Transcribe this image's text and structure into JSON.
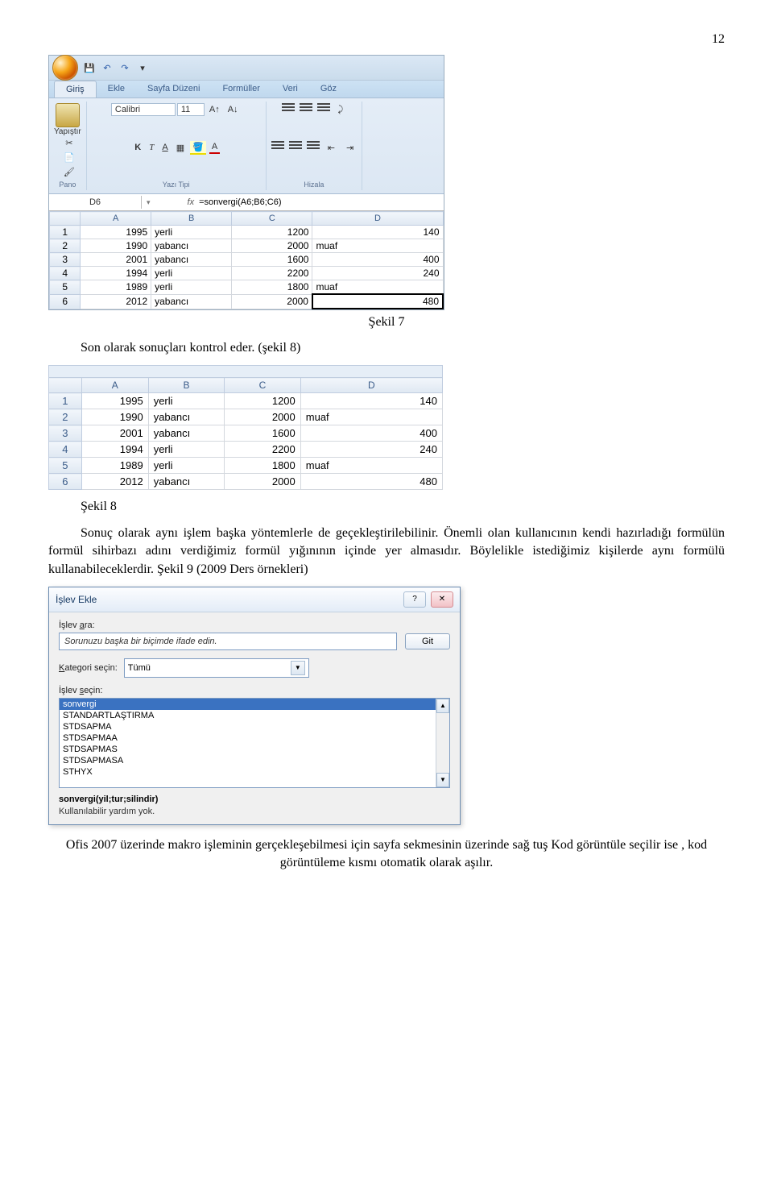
{
  "page_number": "12",
  "excel": {
    "tabs": [
      "Giriş",
      "Ekle",
      "Sayfa Düzeni",
      "Formüller",
      "Veri",
      "Göz"
    ],
    "active_tab_index": 0,
    "clipboard_group_label": "Pano",
    "paste_label": "Yapıştır",
    "font_group_label": "Yazı Tipi",
    "font_name": "Calibri",
    "font_size": "11",
    "align_group_label": "Hizala",
    "name_box_value": "D6",
    "fx_label": "fx",
    "formula_value": "=sonvergi(A6;B6;C6)",
    "columns": [
      "A",
      "B",
      "C",
      "D"
    ],
    "rows": [
      {
        "n": "1",
        "A": "1995",
        "B": "yerli",
        "C": "1200",
        "D": "140"
      },
      {
        "n": "2",
        "A": "1990",
        "B": "yabancı",
        "C": "2000",
        "D": "muaf"
      },
      {
        "n": "3",
        "A": "2001",
        "B": "yabancı",
        "C": "1600",
        "D": "400"
      },
      {
        "n": "4",
        "A": "1994",
        "B": "yerli",
        "C": "2200",
        "D": "240"
      },
      {
        "n": "5",
        "A": "1989",
        "B": "yerli",
        "C": "1800",
        "D": "muaf"
      },
      {
        "n": "6",
        "A": "2012",
        "B": "yabancı",
        "C": "2000",
        "D": "480"
      }
    ],
    "selected_cell": "D6"
  },
  "caption7": "Şekil 7",
  "para_before_sekil8": "Son olarak sonuçları kontrol eder. (şekil 8)",
  "grid8": {
    "columns": [
      "A",
      "B",
      "C",
      "D"
    ],
    "rows": [
      {
        "n": "1",
        "A": "1995",
        "B": "yerli",
        "C": "1200",
        "D": "140"
      },
      {
        "n": "2",
        "A": "1990",
        "B": "yabancı",
        "C": "2000",
        "D": "muaf"
      },
      {
        "n": "3",
        "A": "2001",
        "B": "yabancı",
        "C": "1600",
        "D": "400"
      },
      {
        "n": "4",
        "A": "1994",
        "B": "yerli",
        "C": "2200",
        "D": "240"
      },
      {
        "n": "5",
        "A": "1989",
        "B": "yerli",
        "C": "1800",
        "D": "muaf"
      },
      {
        "n": "6",
        "A": "2012",
        "B": "yabancı",
        "C": "2000",
        "D": "480"
      }
    ]
  },
  "caption8": "Şekil 8",
  "para_after_sekil8": "Sonuç olarak aynı işlem başka yöntemlerle de geçekleştirilebilinir. Önemli olan kullanıcının kendi hazırladığı formülün formül sihirbazı adını verdiğimiz formül yığınının içinde yer almasıdır. Böylelikle istediğimiz kişilerde aynı formülü kullanabileceklerdir. Şekil 9 (2009 Ders örnekleri)",
  "dialog": {
    "title": "İşlev Ekle",
    "search_label_pre": "İşlev ",
    "search_label_ul": "a",
    "search_label_post": "ra:",
    "search_value": "Sorunuzu başka bir biçimde ifade edin.",
    "go_button_ul": "G",
    "go_button_post": "it",
    "category_label_ul": "K",
    "category_label_post": "ategori seçin:",
    "category_value": "Tümü",
    "select_label_pre": "İşlev ",
    "select_label_ul": "s",
    "select_label_post": "eçin:",
    "list_items": [
      "sonvergi",
      "STANDARTLAŞTIRMA",
      "STDSAPMA",
      "STDSAPMAA",
      "STDSAPMAS",
      "STDSAPMASA",
      "STHYX"
    ],
    "selected_item_index": 0,
    "signature": "sonvergi(yil;tur;silindir)",
    "help_text": "Kullanılabilir yardım yok."
  },
  "final_para": "Ofis 2007 üzerinde makro işleminin gerçekleşebilmesi için sayfa sekmesinin üzerinde sağ tuş Kod görüntüle seçilir ise , kod görüntüleme kısmı otomatik olarak aşılır."
}
